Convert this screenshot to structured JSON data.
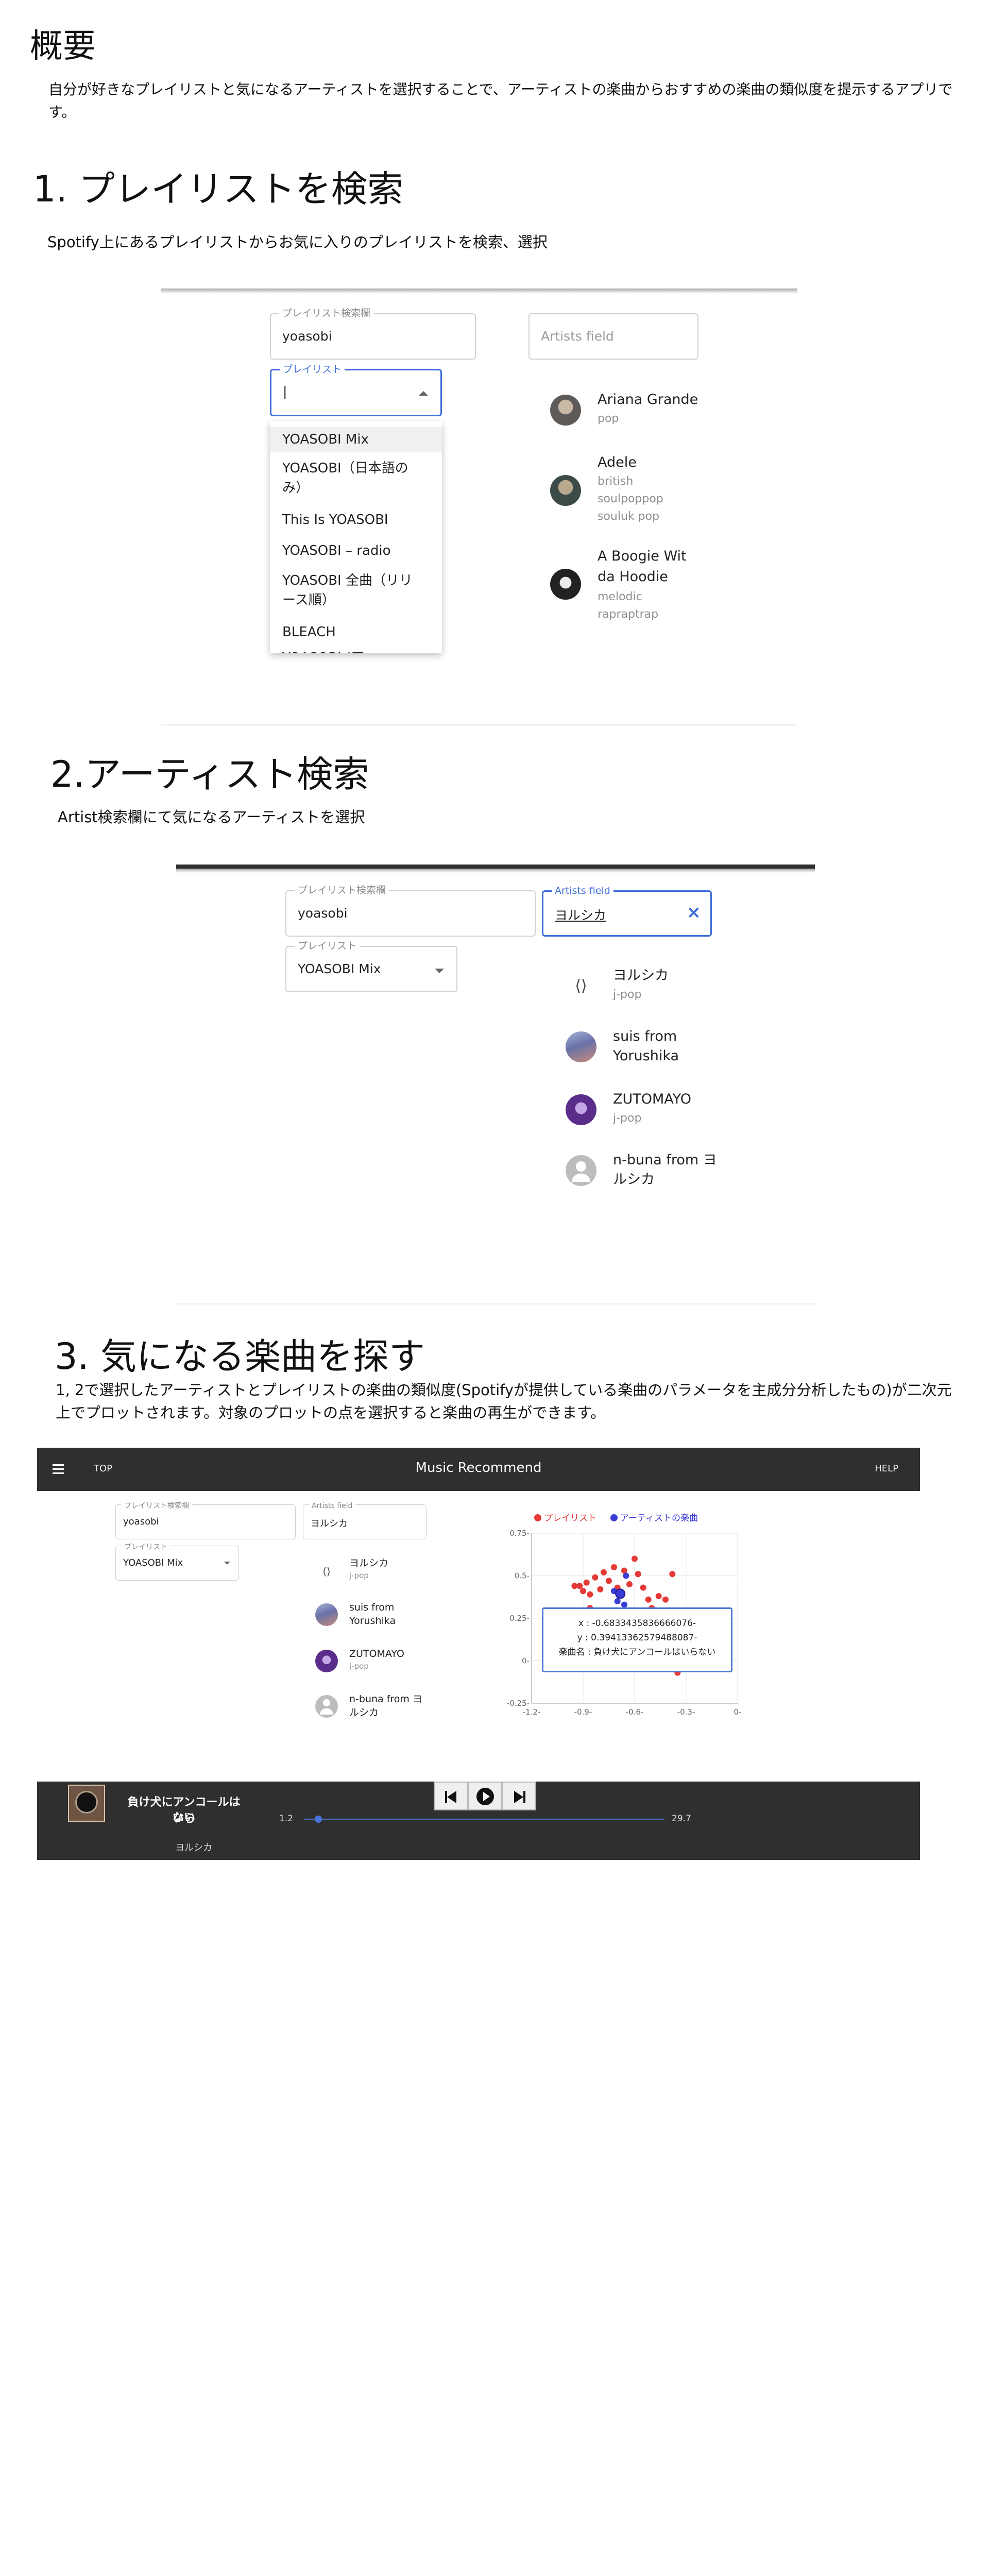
{
  "overview": {
    "title": "概要",
    "body": "自分が好きなプレイリストと気になるアーティストを選択することで、アーティストの楽曲からおすすめの楽曲の類似度を提示するアプリです。"
  },
  "section1": {
    "title": "1. プレイリストを検索",
    "body": "Spotify上にあるプレイリストからお気に入りのプレイリストを検索、選択",
    "playlist_search": {
      "label": "プレイリスト検索欄",
      "value": "yoasobi"
    },
    "artists_field": {
      "placeholder": "Artists field"
    },
    "playlist_select": {
      "label": "プレイリスト",
      "value": "|"
    },
    "dropdown_options": [
      "YOASOBI Mix",
      "YOASOBI（日本語の",
      "み）",
      "This Is YOASOBI",
      "YOASOBI – radio",
      "YOASOBI 全曲（リリ",
      "ース順）",
      "BLEACH",
      "YOASOBI (ア"
    ],
    "artists": [
      {
        "name": "Ariana Grande",
        "genres": [
          "pop"
        ]
      },
      {
        "name": "Adele",
        "genres": [
          "british",
          "soulpoppop",
          "souluk pop"
        ]
      },
      {
        "name_lines": [
          "A Boogie Wit",
          "da Hoodie"
        ],
        "genres": [
          "melodic",
          "rapraptrap"
        ]
      }
    ]
  },
  "section2": {
    "title": "2.アーティスト検索",
    "body": "Artist検索欄にて気になるアーティストを選択",
    "playlist_search": {
      "label": "プレイリスト検索欄",
      "value": "yoasobi"
    },
    "artists_field": {
      "label": "Artists field",
      "value": "ヨルシカ",
      "clear": "×"
    },
    "playlist_select": {
      "label": "プレイリスト",
      "value": "YOASOBI Mix"
    },
    "artists": [
      {
        "name": "ヨルシカ",
        "genre": "j-pop"
      },
      {
        "name_lines": [
          "suis from",
          "Yorushika"
        ]
      },
      {
        "name": "ZUTOMAYO",
        "genre": "j-pop"
      },
      {
        "name_lines": [
          "n-buna from ヨ",
          "ルシカ"
        ]
      }
    ]
  },
  "section3": {
    "title": "3. 気になる楽曲を探す",
    "body": "1, 2で選択したアーティストとプレイリストの楽曲の類似度(Spotifyが提供している楽曲のパラメータを主成分分析したもの)が二次元上でプロットされます。対象のプロットの点を選択すると楽曲の再生ができます。"
  },
  "app": {
    "menu_icon": "menu-icon",
    "top_label": "TOP",
    "title": "Music Recommend",
    "help_label": "HELP",
    "playlist_search": {
      "label": "プレイリスト検索欄",
      "value": "yoasobi"
    },
    "artists_field": {
      "label": "Artists field",
      "value": "ヨルシカ"
    },
    "playlist_select": {
      "label": "プレイリスト",
      "value": "YOASOBI Mix"
    },
    "artists": [
      {
        "name": "ヨルシカ",
        "genre": "j-pop"
      },
      {
        "name_lines": [
          "suis from",
          "Yorushika"
        ]
      },
      {
        "name": "ZUTOMAYO",
        "genre": "j-pop"
      },
      {
        "name_lines": [
          "n-buna from ヨ",
          "ルシカ"
        ]
      }
    ],
    "tooltip": {
      "x": "x : -0.6833435836666076-",
      "y": "y : 0.3941336257948808​7-",
      "song": "楽曲名 : 負け犬にアンコールはいらない"
    }
  },
  "chart_data": {
    "type": "scatter",
    "legend": [
      "プレイリスト",
      "アーティストの楽曲"
    ],
    "legend_colors": [
      "#e53935",
      "#3b3bd6"
    ],
    "xlim": [
      -1.2,
      0
    ],
    "ylim": [
      -0.25,
      0.75
    ],
    "x_ticks": [
      "-1.2-",
      "-0.9-",
      "-0.6-",
      "-0.3-",
      "0-"
    ],
    "y_ticks": [
      "0.75-",
      "0.5-",
      "0.25-",
      "0-",
      "-0.25-"
    ],
    "series": [
      {
        "name": "プレイリスト",
        "color": "#e53935",
        "points": [
          [
            -0.92,
            0.44
          ],
          [
            -0.9,
            0.41
          ],
          [
            -0.88,
            0.46
          ],
          [
            -0.86,
            0.39
          ],
          [
            -0.83,
            0.49
          ],
          [
            -0.8,
            0.42
          ],
          [
            -0.78,
            0.52
          ],
          [
            -0.75,
            0.47
          ],
          [
            -0.72,
            0.55
          ],
          [
            -0.7,
            0.43
          ],
          [
            -0.66,
            0.53
          ],
          [
            -0.63,
            0.45
          ],
          [
            -0.6,
            0.6
          ],
          [
            -0.58,
            0.51
          ],
          [
            -0.55,
            0.43
          ],
          [
            -0.52,
            0.36
          ],
          [
            -0.5,
            0.31
          ],
          [
            -0.46,
            0.38
          ],
          [
            -0.42,
            0.36
          ],
          [
            -0.38,
            0.51
          ],
          [
            -0.86,
            0.31
          ],
          [
            -0.78,
            0.19
          ],
          [
            -0.75,
            0.1
          ],
          [
            -0.7,
            0.09
          ],
          [
            -0.55,
            0.19
          ],
          [
            -0.63,
            0.0
          ],
          [
            -0.45,
            0.24
          ],
          [
            -0.4,
            -0.05
          ],
          [
            -0.35,
            -0.07
          ],
          [
            -0.85,
            -0.05
          ],
          [
            -0.95,
            0.44
          ]
        ]
      },
      {
        "name": "アーティストの楽曲",
        "color": "#3b3bd6",
        "points": [
          [
            -0.72,
            0.41
          ],
          [
            -0.68,
            0.39
          ],
          [
            -0.65,
            0.5
          ],
          [
            -0.7,
            0.35
          ],
          [
            -0.66,
            0.33
          ],
          [
            -1.0,
            0.0
          ]
        ]
      }
    ],
    "selected_point": {
      "x": -0.6833435836666076,
      "y": 0.39413362579488087
    }
  },
  "player": {
    "song_lines": [
      "負け犬にアンコールはいら",
      "ない"
    ],
    "artist": "ヨルシカ",
    "current_time": "1.2",
    "duration": "29.7",
    "progress": 0.04,
    "controls": [
      "skip-previous-icon",
      "play-icon",
      "skip-next-icon"
    ]
  }
}
